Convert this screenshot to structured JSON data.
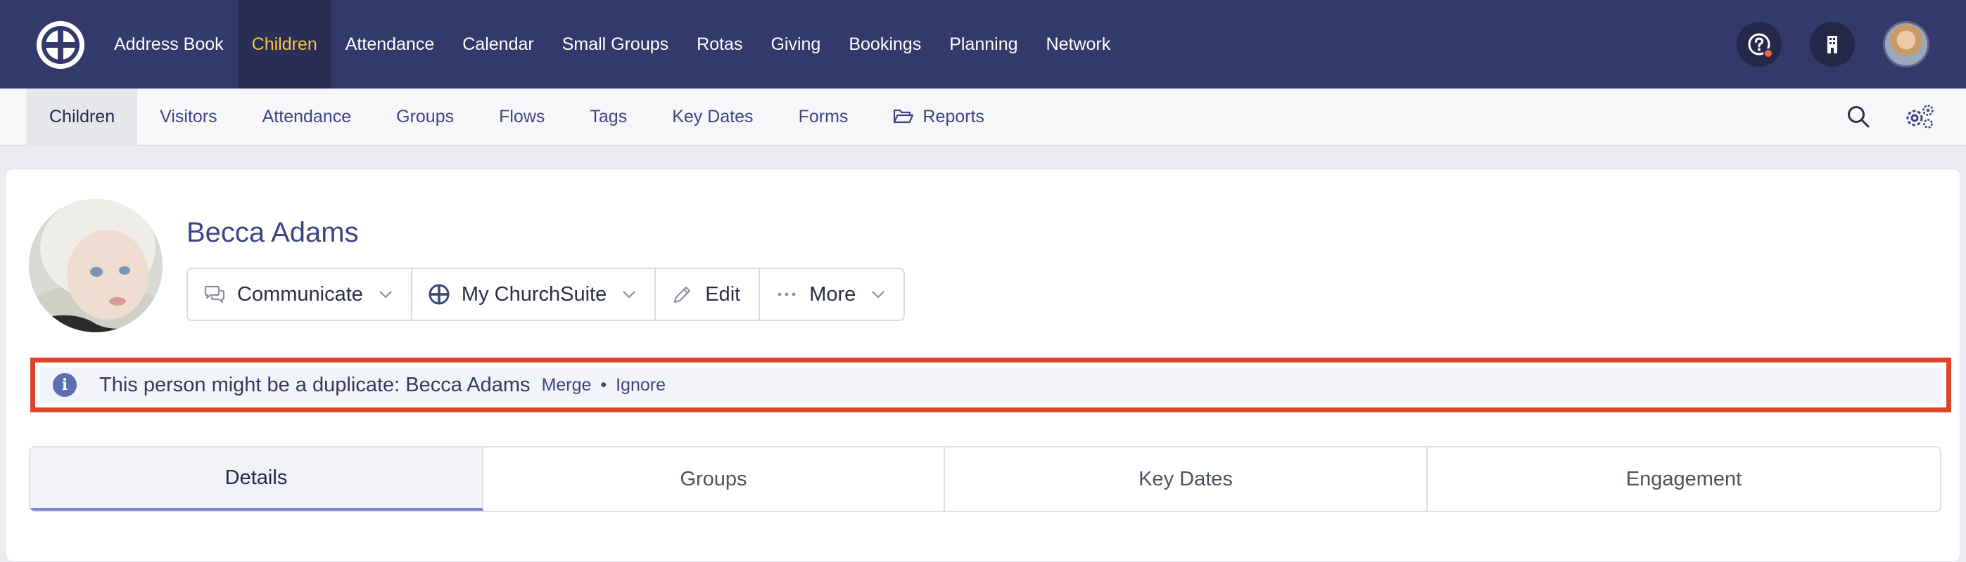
{
  "topnav": {
    "items": [
      {
        "label": "Address Book"
      },
      {
        "label": "Children",
        "active": true
      },
      {
        "label": "Attendance"
      },
      {
        "label": "Calendar"
      },
      {
        "label": "Small Groups"
      },
      {
        "label": "Rotas"
      },
      {
        "label": "Giving"
      },
      {
        "label": "Bookings"
      },
      {
        "label": "Planning"
      },
      {
        "label": "Network"
      }
    ],
    "right_icons": [
      "help-icon",
      "building-icon",
      "user-avatar"
    ],
    "colors": {
      "background": "#33396b",
      "active_bg": "#292e57",
      "active_text": "#f5c243",
      "notification": "#ef6a3b"
    }
  },
  "subnav": {
    "items": [
      {
        "label": "Children",
        "active": true
      },
      {
        "label": "Visitors"
      },
      {
        "label": "Attendance"
      },
      {
        "label": "Groups"
      },
      {
        "label": "Flows"
      },
      {
        "label": "Tags"
      },
      {
        "label": "Key Dates"
      },
      {
        "label": "Forms"
      },
      {
        "label": "Reports",
        "icon": "folder-open-icon"
      }
    ],
    "tools": [
      "search-icon",
      "settings-icon"
    ]
  },
  "profile": {
    "name": "Becca Adams",
    "actions": [
      {
        "label": "Communicate",
        "icon": "chat-icon",
        "dropdown": true
      },
      {
        "label": "My ChurchSuite",
        "icon": "churchsuite-icon",
        "dropdown": true
      },
      {
        "label": "Edit",
        "icon": "pencil-icon",
        "dropdown": false
      },
      {
        "label": "More",
        "icon": "ellipsis-icon",
        "dropdown": true
      }
    ]
  },
  "duplicate_alert": {
    "message": "This person might be a duplicate: Becca Adams",
    "merge_label": "Merge",
    "separator": "•",
    "ignore_label": "Ignore",
    "highlight_color": "#e0432d"
  },
  "tabs": [
    {
      "label": "Details",
      "active": true
    },
    {
      "label": "Groups"
    },
    {
      "label": "Key Dates"
    },
    {
      "label": "Engagement"
    }
  ]
}
